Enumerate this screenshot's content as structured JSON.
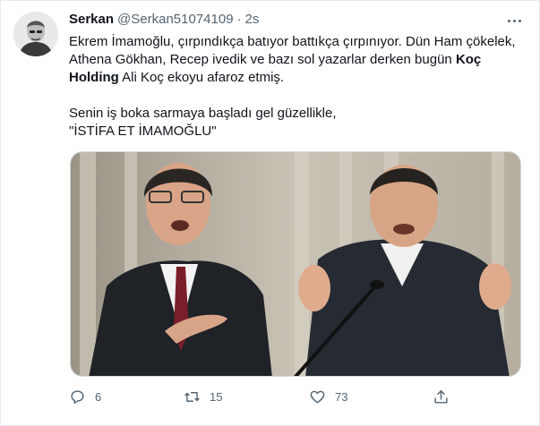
{
  "tweet": {
    "display_name": "Serkan",
    "handle": "@Serkan51074109",
    "separator": "·",
    "time": "2s",
    "lines": {
      "line1": "Ekrem İmamoğlu, çırpındıkça batıyor battıkça çırpınıyor. Dün Ham çökelek,",
      "line2": "Athena Gökhan, Recep ivedik ve bazı sol yazarlar derken bugün",
      "line3_bold": "Holding",
      "line2_bold": "Koç",
      "line3_rest": "Ali Koç ekoyu afaroz etmiş.",
      "line4": "Senin iş boka sarmaya başladı gel güzellikle,",
      "line5": "\"İSTİFA ET İMAMOĞLU\""
    }
  },
  "stats": {
    "replies": "6",
    "retweets": "15",
    "likes": "73"
  },
  "icons": {
    "reply": "reply-icon",
    "retweet": "retweet-icon",
    "like": "heart-icon",
    "share": "share-icon",
    "more": "more-icon"
  },
  "colors": {
    "text": "#0f1419",
    "secondary": "#536471",
    "border": "#cfd9de"
  }
}
